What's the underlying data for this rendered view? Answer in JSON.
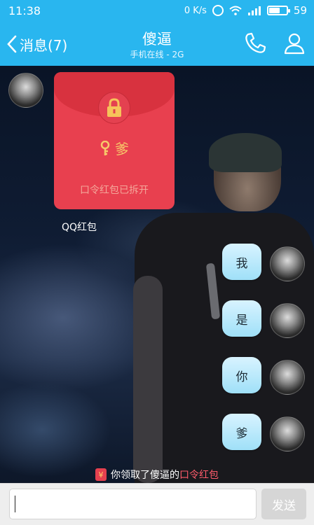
{
  "status_bar": {
    "time": "11:38",
    "net_speed": "0 K/s",
    "battery": "59",
    "battery_fraction": 0.59
  },
  "header": {
    "back_label": "消息(7)",
    "title": "傻逼",
    "subtitle": "手机在线 - 2G"
  },
  "red_packet": {
    "password": "爹",
    "status": "口令红包已拆开",
    "caption": "QQ红包"
  },
  "messages": [
    {
      "text": "我"
    },
    {
      "text": "是"
    },
    {
      "text": "你"
    },
    {
      "text": "爹"
    }
  ],
  "notice": {
    "prefix": "你领取了傻逼的",
    "highlight": "口令红包",
    "icon": "¥"
  },
  "input": {
    "value": "",
    "send_label": "发送"
  },
  "colors": {
    "header": "#29b6ef",
    "red_packet": "#e8404f",
    "bubble": "#bfeafb",
    "highlight": "#ff5c6b"
  }
}
